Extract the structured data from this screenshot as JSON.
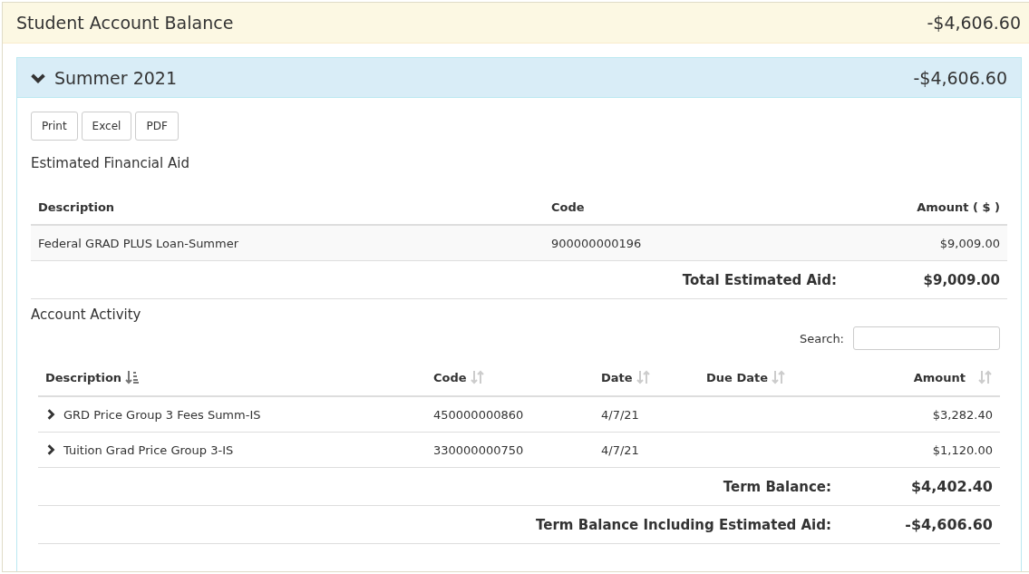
{
  "balance_header": {
    "title": "Student Account Balance",
    "amount": "-$4,606.60"
  },
  "term": {
    "title": "Summer 2021",
    "amount": "-$4,606.60",
    "expanded": true,
    "export_buttons": [
      "Print",
      "Excel",
      "PDF"
    ],
    "financial_aid": {
      "heading": "Estimated Financial Aid",
      "columns": [
        "Description",
        "Code",
        "Amount ( $ )"
      ],
      "rows": [
        {
          "description": "Federal GRAD PLUS Loan-Summer",
          "code": "900000000196",
          "amount": "$9,009.00"
        }
      ],
      "total_label": "Total Estimated Aid:",
      "total_amount": "$9,009.00"
    },
    "account_activity": {
      "heading": "Account Activity",
      "search": {
        "label": "Search:"
      },
      "columns": [
        {
          "label": "Description",
          "sorted": true
        },
        {
          "label": "Code",
          "sorted": false
        },
        {
          "label": "Date",
          "sorted": false
        },
        {
          "label": "Due Date",
          "sorted": false
        },
        {
          "label": "Amount",
          "sorted": false
        }
      ],
      "rows": [
        {
          "expanded": false,
          "description": "GRD Price Group 3 Fees Summ-IS",
          "code": "450000000860",
          "date": "4/7/21",
          "amount": "$3,282.40"
        },
        {
          "expanded": false,
          "description": "Tuition Grad Price Group 3-IS",
          "code": "330000000750",
          "date": "4/7/21",
          "amount": "$1,120.00"
        }
      ],
      "totals": [
        {
          "label": "Term Balance:",
          "amount": "$4,402.40"
        },
        {
          "label": "Term Balance Including Estimated Aid:",
          "amount": "-$4,606.60"
        }
      ]
    }
  }
}
